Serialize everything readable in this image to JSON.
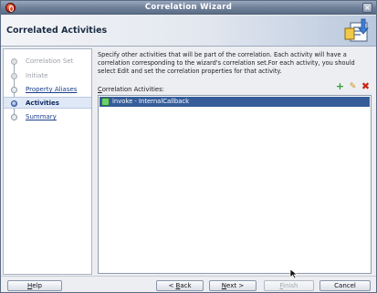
{
  "window": {
    "title": "Correlation Wizard",
    "close_glyph": "×"
  },
  "header": {
    "title": "Correlated Activities",
    "graphic": "wizard-banner-icon"
  },
  "steps": [
    {
      "label": "Correlation Set",
      "state": "done"
    },
    {
      "label": "Initiate",
      "state": "done"
    },
    {
      "label": "Property Aliases",
      "state": "link"
    },
    {
      "label": "Activities",
      "state": "active"
    },
    {
      "label": "Summary",
      "state": "link"
    }
  ],
  "content": {
    "description": "Specify other activities that will be part of the correlation. Each activity will have a correlation corresponding to the wizard's correlation set.For each activity, you should select Edit and set the correlation properties for that activity.",
    "list_label": "Correlation Activities:",
    "list_label_mnemonic": "C",
    "list_label_rest": "orrelation Activities:",
    "tools": {
      "add": "+",
      "edit": "✎",
      "delete": "✖"
    },
    "items": [
      {
        "text": "invoke - InternalCallback",
        "selected": true
      }
    ]
  },
  "footer": {
    "help": {
      "mnemonic": "H",
      "rest": "elp"
    },
    "back": {
      "prefix": "< ",
      "mnemonic": "B",
      "rest": "ack"
    },
    "next": {
      "mnemonic": "N",
      "rest": "ext >"
    },
    "finish": {
      "mnemonic": "F",
      "rest": "inish",
      "disabled": true
    },
    "cancel": "Cancel"
  },
  "colors": {
    "selection": "#365d9a",
    "title_bar": "#6e7f98",
    "link": "#1a3e8c",
    "add": "#2fa12f",
    "delete": "#c8261b"
  }
}
